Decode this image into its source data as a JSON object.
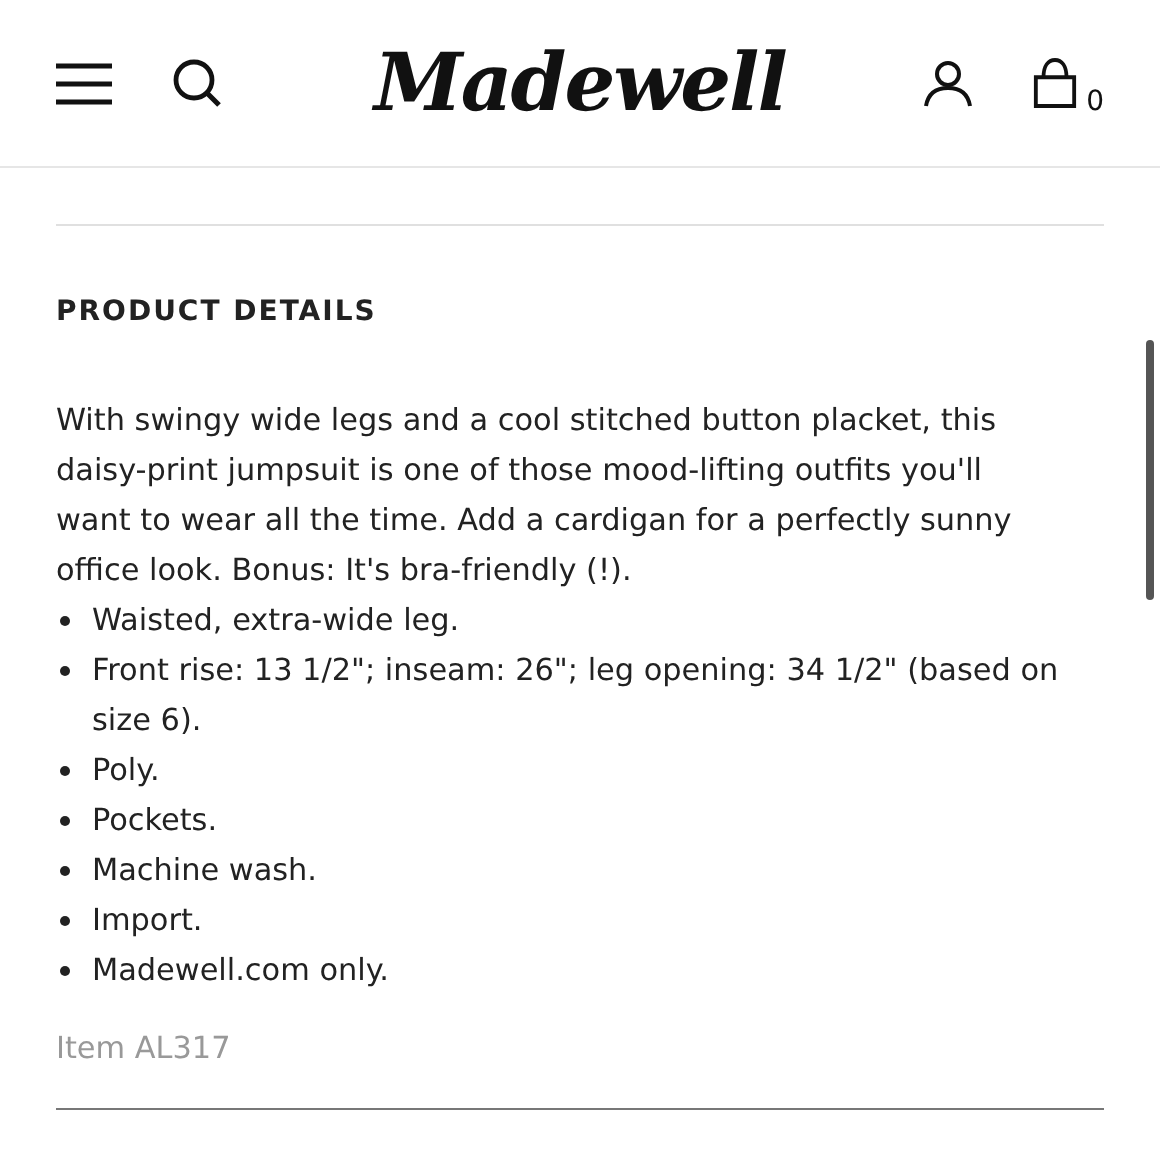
{
  "header": {
    "logo": "Madewell",
    "cart_count": "0"
  },
  "section": {
    "title": "PRODUCT DETAILS",
    "description": "With swingy wide legs and a cool stitched button placket, this daisy-print jumpsuit is one of those mood-lifting outfits you'll want to wear all the time. Add a cardigan for a perfectly sunny office look. Bonus: It's bra-friendly (!).",
    "bullets": [
      "Waisted, extra-wide leg.",
      "Front rise: 13 1/2\"; inseam: 26\"; leg opening: 34 1/2\" (based on size 6).",
      "Poly.",
      "Pockets.",
      "Machine wash.",
      "Import.",
      "Madewell.com only."
    ],
    "item_number": "Item AL317"
  }
}
